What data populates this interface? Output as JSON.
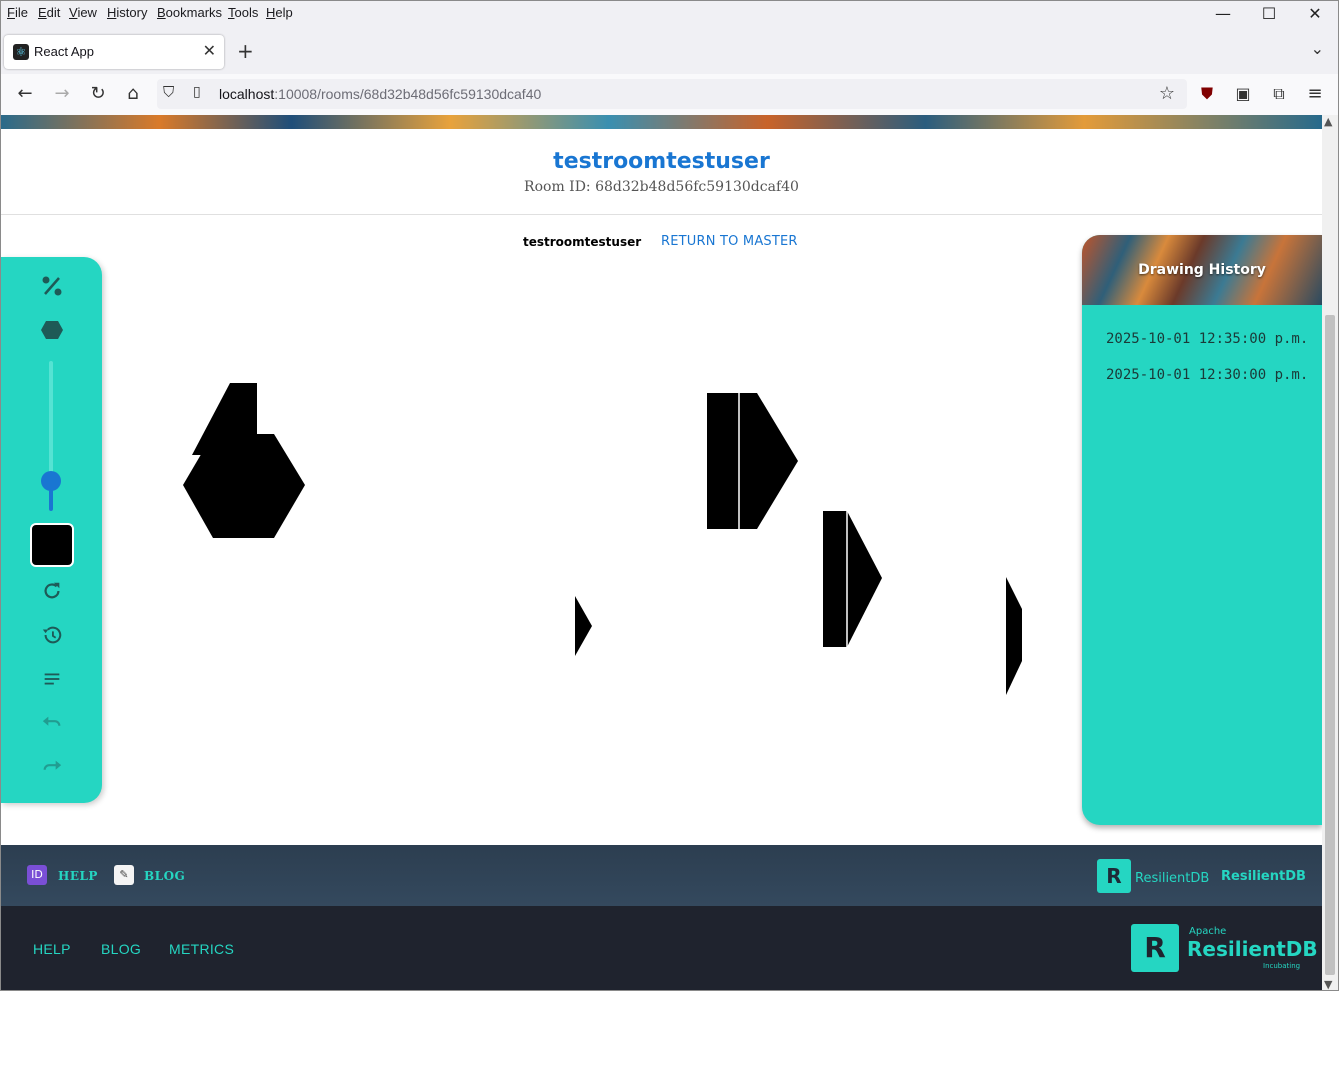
{
  "menubar": {
    "items": [
      "File",
      "Edit",
      "View",
      "History",
      "Bookmarks",
      "Tools",
      "Help"
    ],
    "minimize": "—",
    "maximize": "☐",
    "close": "✕"
  },
  "tab": {
    "title": "React App",
    "close": "✕",
    "new_tab": "+",
    "list_all": "⌄"
  },
  "navbar": {
    "url_host": "localhost",
    "url_path": ":10008/rooms/68d32b48d56fc59130dcaf40"
  },
  "page": {
    "room_title": "testroomtestuser",
    "room_id": "Room ID: 68d32b48d56fc59130dcaf40",
    "user_label": "testroomtestuser",
    "return_link": "RETURN TO MASTER"
  },
  "toolbar": {
    "tools": [
      "percent-icon",
      "hexagon-shape-icon",
      "refresh-icon",
      "history-icon",
      "text-lines-icon",
      "undo-icon",
      "redo-icon"
    ],
    "brush_size": 0.2,
    "color": "#000000"
  },
  "history": {
    "title": "Drawing History",
    "items": [
      "2025-10-01 12:35:00 p.m.",
      "2025-10-01 12:30:00 p.m."
    ]
  },
  "footer1": {
    "help": "HELP",
    "blog": "BLOG",
    "logo_text": "ResilientDB",
    "brand": "ResilientDB"
  },
  "footer2": {
    "help": "HELP",
    "blog": "BLOG",
    "metrics": "METRICS",
    "logo_apache": "Apache",
    "logo_name": "ResilientDB",
    "logo_incubating": "Incubating"
  },
  "colors": {
    "accent": "#25d6c2",
    "link": "#1976d2",
    "footer_dark": "#1f232e",
    "footer_mid": "#2c3e50"
  }
}
